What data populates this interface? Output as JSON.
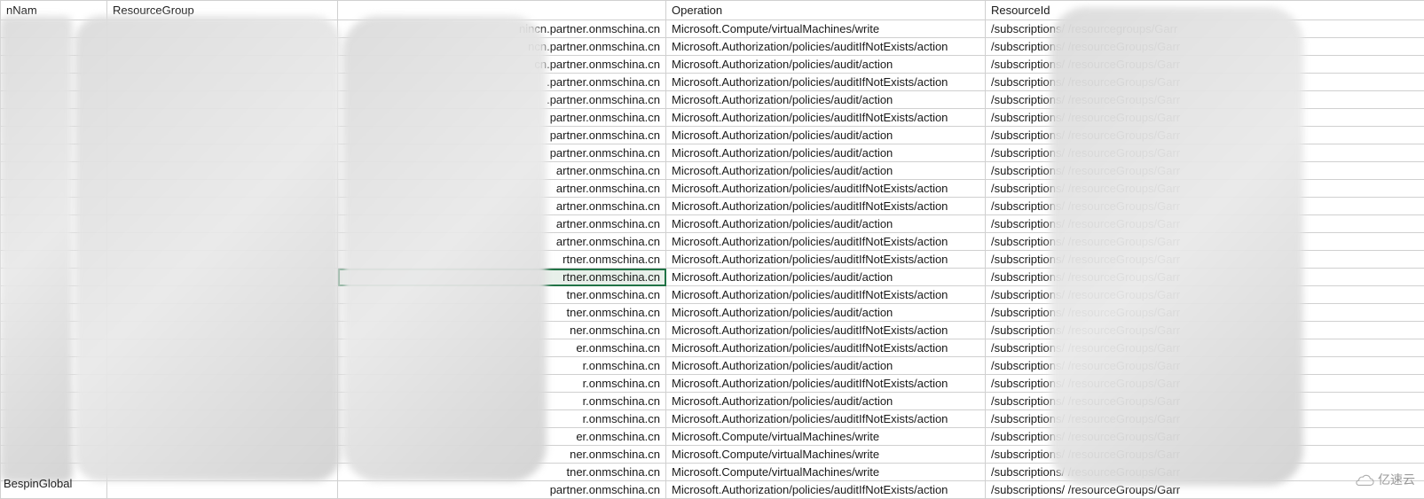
{
  "headers": {
    "col_a": "nNam",
    "col_b": "ResourceGroup",
    "col_c": "",
    "col_d": "Operation",
    "col_e": "ResourceId"
  },
  "footer_left": "BespinGlobal",
  "watermark": "亿速云",
  "rows": [
    {
      "c": "nincn.partner.onmschina.cn",
      "d": "Microsoft.Compute/virtualMachines/write",
      "e": "/subscriptions/",
      "f": "/resourcegroups/Garr"
    },
    {
      "c": "ncn.partner.onmschina.cn",
      "d": "Microsoft.Authorization/policies/auditIfNotExists/action",
      "e": "/subscriptions/",
      "f": "/resourceGroups/Garr"
    },
    {
      "c": "cn.partner.onmschina.cn",
      "d": "Microsoft.Authorization/policies/audit/action",
      "e": "/subscriptions/",
      "f": "/resourceGroups/Garr"
    },
    {
      "c": ".partner.onmschina.cn",
      "d": "Microsoft.Authorization/policies/auditIfNotExists/action",
      "e": "/subscriptions/",
      "f": "/resourceGroups/Garr"
    },
    {
      "c": ".partner.onmschina.cn",
      "d": "Microsoft.Authorization/policies/audit/action",
      "e": "/subscriptions/",
      "f": "/resourceGroups/Garr"
    },
    {
      "c": "partner.onmschina.cn",
      "d": "Microsoft.Authorization/policies/auditIfNotExists/action",
      "e": "/subscriptions/",
      "f": "/resourceGroups/Garr"
    },
    {
      "c": "partner.onmschina.cn",
      "d": "Microsoft.Authorization/policies/audit/action",
      "e": "/subscriptions/",
      "f": "/resourceGroups/Garr"
    },
    {
      "c": "partner.onmschina.cn",
      "d": "Microsoft.Authorization/policies/audit/action",
      "e": "/subscriptions/",
      "f": "/resourceGroups/Garr"
    },
    {
      "c": "artner.onmschina.cn",
      "d": "Microsoft.Authorization/policies/audit/action",
      "e": "/subscriptions/",
      "f": "/resourceGroups/Garr"
    },
    {
      "c": "artner.onmschina.cn",
      "d": "Microsoft.Authorization/policies/auditIfNotExists/action",
      "e": "/subscriptions/",
      "f": "/resourceGroups/Garr"
    },
    {
      "c": "artner.onmschina.cn",
      "d": "Microsoft.Authorization/policies/auditIfNotExists/action",
      "e": "/subscriptions/",
      "f": "/resourceGroups/Garr"
    },
    {
      "c": "artner.onmschina.cn",
      "d": "Microsoft.Authorization/policies/audit/action",
      "e": "/subscriptions/",
      "f": "/resourceGroups/Garr"
    },
    {
      "c": "artner.onmschina.cn",
      "d": "Microsoft.Authorization/policies/auditIfNotExists/action",
      "e": "/subscriptions/",
      "f": "/resourceGroups/Garr"
    },
    {
      "c": "rtner.onmschina.cn",
      "d": "Microsoft.Authorization/policies/auditIfNotExists/action",
      "e": "/subscriptions/",
      "f": "/resourceGroups/Garr"
    },
    {
      "c": "rtner.onmschina.cn",
      "d": "Microsoft.Authorization/policies/audit/action",
      "e": "/subscriptions/",
      "f": "/resourceGroups/Garr",
      "selected": true
    },
    {
      "c": "tner.onmschina.cn",
      "d": "Microsoft.Authorization/policies/auditIfNotExists/action",
      "e": "/subscriptions/",
      "f": "/resourceGroups/Garr"
    },
    {
      "c": "tner.onmschina.cn",
      "d": "Microsoft.Authorization/policies/audit/action",
      "e": "/subscriptions/",
      "f": "/resourceGroups/Garr"
    },
    {
      "c": "ner.onmschina.cn",
      "d": "Microsoft.Authorization/policies/auditIfNotExists/action",
      "e": "/subscriptions/",
      "f": "/resourceGroups/Garr"
    },
    {
      "c": "er.onmschina.cn",
      "d": "Microsoft.Authorization/policies/auditIfNotExists/action",
      "e": "/subscriptions/",
      "f": "/resourceGroups/Garr"
    },
    {
      "c": "r.onmschina.cn",
      "d": "Microsoft.Authorization/policies/audit/action",
      "e": "/subscriptions/",
      "f": "/resourceGroups/Garr"
    },
    {
      "c": "r.onmschina.cn",
      "d": "Microsoft.Authorization/policies/auditIfNotExists/action",
      "e": "/subscriptions/",
      "f": "/resourceGroups/Garr"
    },
    {
      "c": "r.onmschina.cn",
      "d": "Microsoft.Authorization/policies/audit/action",
      "e": "/subscriptions/",
      "f": "/resourceGroups/Garr"
    },
    {
      "c": "r.onmschina.cn",
      "d": "Microsoft.Authorization/policies/auditIfNotExists/action",
      "e": "/subscriptions/",
      "f": "/resourceGroups/Garr"
    },
    {
      "c": "er.onmschina.cn",
      "d": "Microsoft.Compute/virtualMachines/write",
      "e": "/subscriptions/",
      "f": "/resourceGroups/Garr"
    },
    {
      "c": "ner.onmschina.cn",
      "d": "Microsoft.Compute/virtualMachines/write",
      "e": "/subscriptions/",
      "f": "/resourceGroups/Garr"
    },
    {
      "c": "tner.onmschina.cn",
      "d": "Microsoft.Compute/virtualMachines/write",
      "e": "/subscriptions/",
      "f": "/resourceGroups/Garr"
    },
    {
      "c": "partner.onmschina.cn",
      "d": "Microsoft.Authorization/policies/auditIfNotExists/action",
      "e": "/subscriptions/",
      "f": "/resourceGroups/Garr"
    }
  ]
}
